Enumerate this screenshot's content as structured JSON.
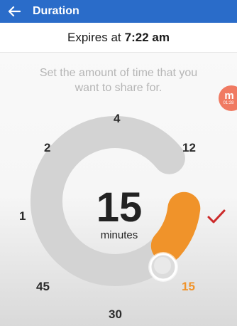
{
  "appbar": {
    "title": "Duration",
    "back_icon": "arrow-left-icon",
    "color": "#2a6cc9"
  },
  "expires": {
    "prefix": "Expires at",
    "time": "7:22 am"
  },
  "instruction": "Set the amount of time that you want to share for.",
  "floating_badge": {
    "letter": "m",
    "time": "01:28",
    "color": "#f07a62"
  },
  "dial": {
    "labels": {
      "top": "4",
      "upper_left": "2",
      "upper_right": "12",
      "left": "1",
      "lower_left": "45",
      "lower_right": "15",
      "bottom": "30"
    },
    "selected": {
      "value": "15",
      "unit": "minutes"
    },
    "track_color": "#d3d3d3",
    "accent_color": "#f0932a"
  },
  "confirm_icon": "checkmark-icon",
  "confirm_color": "#cc2a2a"
}
